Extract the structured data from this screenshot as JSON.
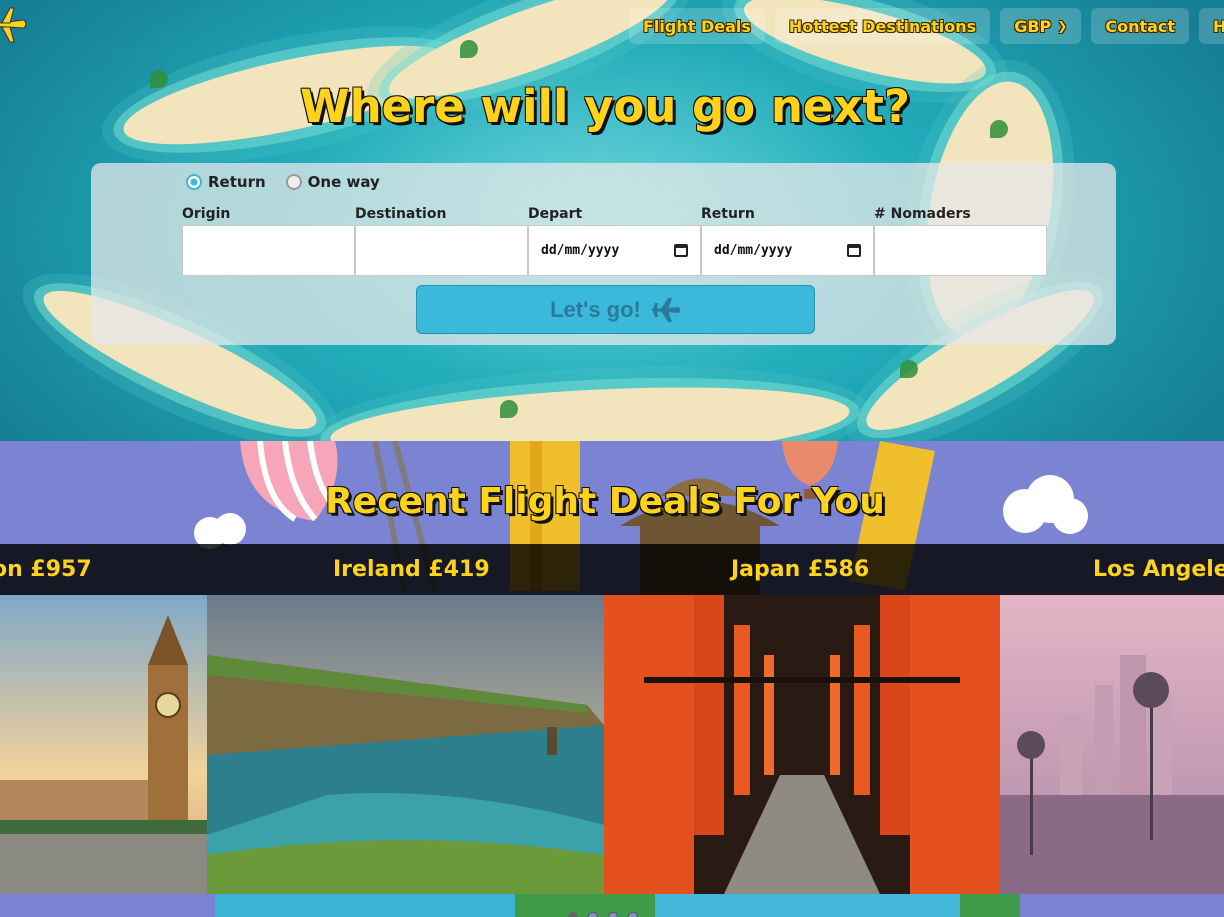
{
  "nav": {
    "items": [
      {
        "label": "Flight Deals"
      },
      {
        "label": "Hottest Destinations"
      },
      {
        "label": "GBP"
      },
      {
        "label": "Contact"
      },
      {
        "label": "Ho"
      }
    ]
  },
  "hero": {
    "title": "Where will you go next?"
  },
  "search": {
    "trip_types": [
      "Return",
      "One way"
    ],
    "selected_trip_type": "Return",
    "fields": {
      "origin_label": "Origin",
      "destination_label": "Destination",
      "depart_label": "Depart",
      "return_label": "Return",
      "nomaders_label": "# Nomaders",
      "date_placeholder": "dd/mm/yyyy"
    },
    "submit_label": "Let's go!"
  },
  "deals": {
    "title": "Recent Flight Deals For You",
    "ticker": [
      "on £957",
      "Ireland £419",
      "Japan £586",
      "Los Angeles"
    ]
  },
  "colors": {
    "accent_yellow": "#ffd21c",
    "button_blue": "#3ab9dc",
    "section_purple": "#7b84d3"
  }
}
